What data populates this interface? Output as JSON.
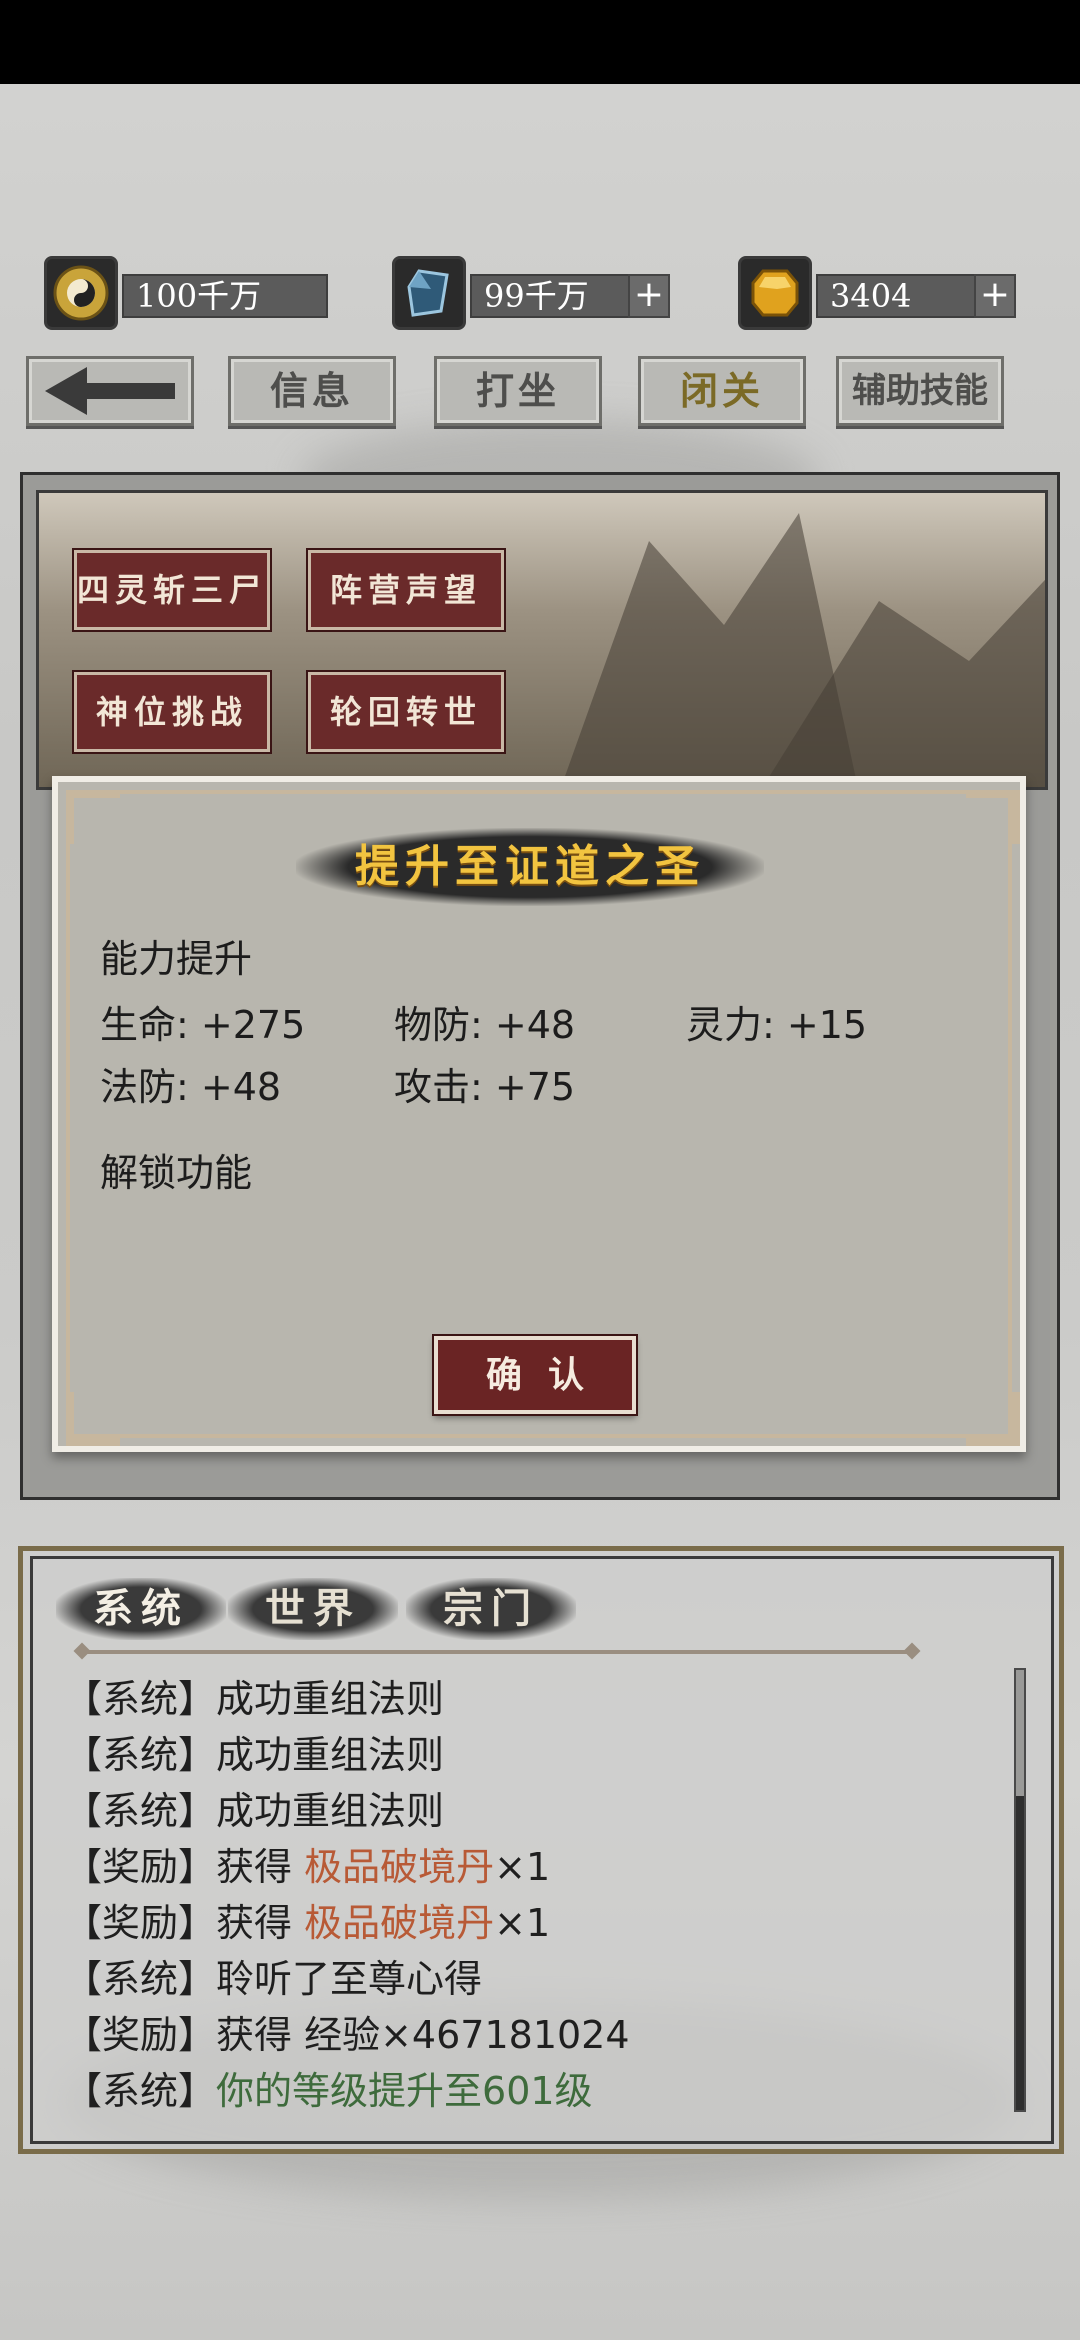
{
  "currencies": [
    {
      "icon": "yin-yang-coin-icon",
      "value": "100千万",
      "plus": ""
    },
    {
      "icon": "blue-crystal-icon",
      "value": "99千万",
      "plus": "+"
    },
    {
      "icon": "gold-gem-icon",
      "value": "3404",
      "plus": "+"
    }
  ],
  "nav": {
    "back_icon": "back-arrow-icon",
    "tabs": [
      "信息",
      "打坐",
      "闭关",
      "辅助技能"
    ],
    "active_tab": "闭关"
  },
  "scene_buttons": [
    "四灵斩三尸",
    "阵营声望",
    "神位挑战",
    "轮回转世"
  ],
  "dialog": {
    "title": "提升至证道之圣",
    "ability_heading": "能力提升",
    "stats": [
      [
        "生命: +275",
        "物防: +48",
        "灵力: +15"
      ],
      [
        "法防: +48",
        "攻击: +75"
      ]
    ],
    "unlock_heading": "解锁功能",
    "confirm_label": "确认"
  },
  "chat": {
    "tabs": [
      "系统",
      "世界",
      "宗门"
    ],
    "lines": [
      {
        "tag": "【系统】",
        "text": "成功重组法则",
        "highlight": "",
        "suffix": ""
      },
      {
        "tag": "【系统】",
        "text": "成功重组法则",
        "highlight": "",
        "suffix": ""
      },
      {
        "tag": "【系统】",
        "text": "成功重组法则",
        "highlight": "",
        "suffix": ""
      },
      {
        "tag": "【奖励】",
        "text": "获得 ",
        "highlight": "极品破境丹",
        "suffix": "×1"
      },
      {
        "tag": "【奖励】",
        "text": "获得 ",
        "highlight": "极品破境丹",
        "suffix": "×1"
      },
      {
        "tag": "【系统】",
        "text": "聆听了至尊心得",
        "highlight": "",
        "suffix": ""
      },
      {
        "tag": "【奖励】",
        "text": "获得 经验×467181024",
        "highlight": "",
        "suffix": ""
      },
      {
        "tag": "【系统】",
        "text": "",
        "highlight_green": "你的等级提升至601级",
        "suffix": ""
      }
    ]
  },
  "colors": {
    "accent_red": "#6a2a2a",
    "title_gold": "#f2c440",
    "highlight_orange": "#b85a36",
    "highlight_green": "#3e6b3c"
  }
}
